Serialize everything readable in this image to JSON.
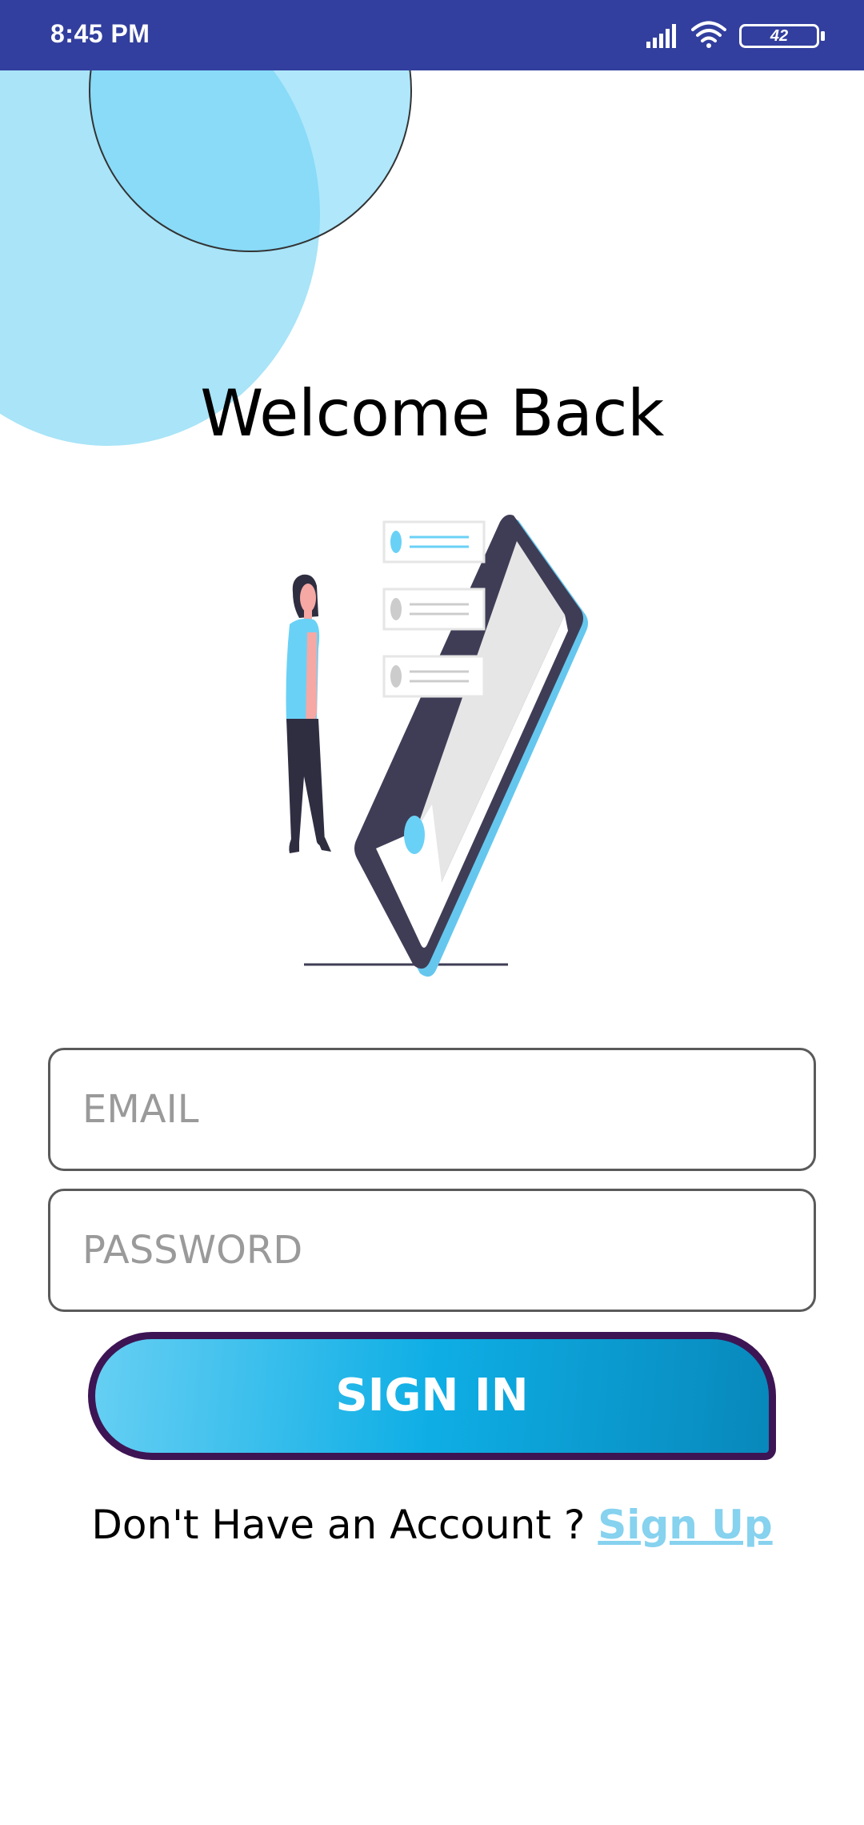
{
  "status_bar": {
    "time": "8:45 PM",
    "battery": "42",
    "icons": [
      "signal-icon",
      "wifi-icon",
      "battery-icon"
    ]
  },
  "login": {
    "title": "Welcome Back",
    "email_placeholder": "EMAIL",
    "password_placeholder": "PASSWORD",
    "signin_label": "SIGN IN",
    "footer_prompt": "Don't Have an Account ?",
    "signup_label": "Sign Up"
  },
  "colors": {
    "status_bar": "#323f9e",
    "accent": "#0eaee5",
    "button_border": "#3d1554",
    "link": "#86d2ef",
    "circle": "#a9e4f8"
  }
}
